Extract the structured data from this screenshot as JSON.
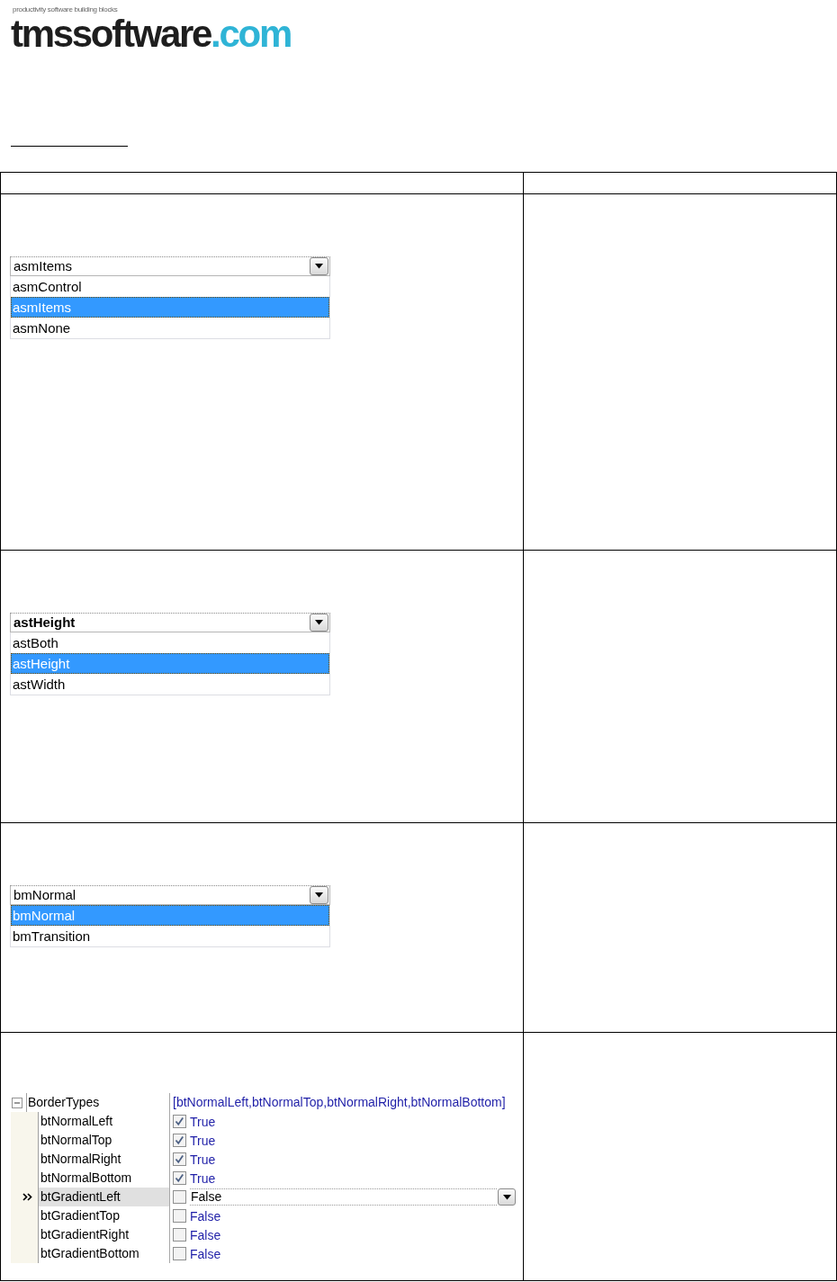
{
  "logo": {
    "tagline": "productivity software building blocks",
    "name": "tmssoftware",
    "domain": ".com"
  },
  "table": {
    "rows": [
      {
        "kind": "dropdown",
        "combo": {
          "value": "asmItems",
          "bold": false
        },
        "options": [
          {
            "label": "asmControl",
            "selected": false
          },
          {
            "label": "asmItems",
            "selected": true
          },
          {
            "label": "asmNone",
            "selected": false
          }
        ]
      },
      {
        "kind": "dropdown",
        "combo": {
          "value": "astHeight",
          "bold": true
        },
        "options": [
          {
            "label": "astBoth",
            "selected": false
          },
          {
            "label": "astHeight",
            "selected": true
          },
          {
            "label": "astWidth",
            "selected": false
          }
        ]
      },
      {
        "kind": "dropdown",
        "combo": {
          "value": "bmNormal",
          "bold": false
        },
        "options": [
          {
            "label": "bmNormal",
            "selected": true
          },
          {
            "label": "bmTransition",
            "selected": false
          }
        ]
      },
      {
        "kind": "property_grid",
        "property": {
          "name": "BorderTypes",
          "expanded": true,
          "value": "[btNormalLeft,btNormalTop,btNormalRight,btNormalBottom]"
        },
        "children": [
          {
            "name": "btNormalLeft",
            "checked": true,
            "value": "True",
            "selected": false
          },
          {
            "name": "btNormalTop",
            "checked": true,
            "value": "True",
            "selected": false
          },
          {
            "name": "btNormalRight",
            "checked": true,
            "value": "True",
            "selected": false
          },
          {
            "name": "btNormalBottom",
            "checked": true,
            "value": "True",
            "selected": false
          },
          {
            "name": "btGradientLeft",
            "checked": false,
            "value": "False",
            "selected": true
          },
          {
            "name": "btGradientTop",
            "checked": false,
            "value": "False",
            "selected": false
          },
          {
            "name": "btGradientRight",
            "checked": false,
            "value": "False",
            "selected": false
          },
          {
            "name": "btGradientBottom",
            "checked": false,
            "value": "False",
            "selected": false
          }
        ]
      }
    ]
  }
}
